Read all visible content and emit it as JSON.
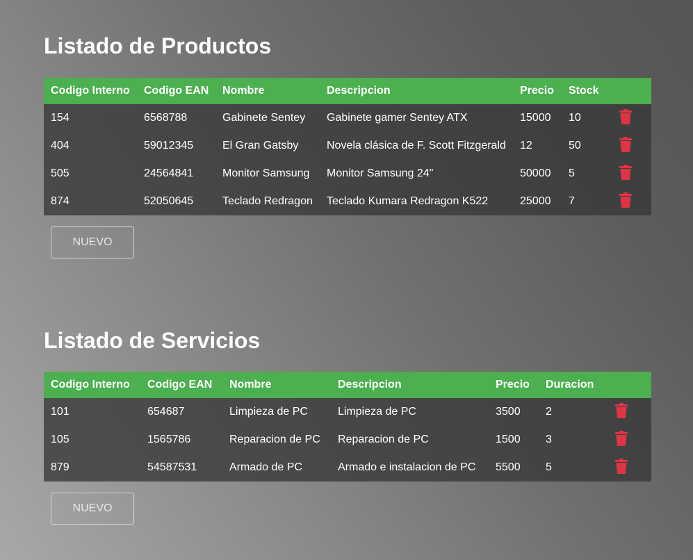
{
  "products": {
    "title": "Listado de Productos",
    "headers": [
      "Codigo Interno",
      "Codigo EAN",
      "Nombre",
      "Descripcion",
      "Precio",
      "Stock"
    ],
    "rows": [
      [
        "154",
        "6568788",
        "Gabinete Sentey",
        "Gabinete gamer Sentey ATX",
        "15000",
        "10"
      ],
      [
        "404",
        "59012345",
        "El Gran Gatsby",
        "Novela clásica de F. Scott Fitzgerald",
        "12",
        "50"
      ],
      [
        "505",
        "24564841",
        "Monitor Samsung",
        "Monitor Samsung 24\"",
        "50000",
        "5"
      ],
      [
        "874",
        "52050645",
        "Teclado Redragon",
        "Teclado Kumara Redragon K522",
        "25000",
        "7"
      ]
    ],
    "new_button": "NUEVO"
  },
  "services": {
    "title": "Listado de Servicios",
    "headers": [
      "Codigo Interno",
      "Codigo EAN",
      "Nombre",
      "Descripcion",
      "Precio",
      "Duracion"
    ],
    "rows": [
      [
        "101",
        "654687",
        "Limpieza de PC",
        "Limpieza de PC",
        "3500",
        "2"
      ],
      [
        "105",
        "1565786",
        "Reparacion de PC",
        "Reparacion de PC",
        "1500",
        "3"
      ],
      [
        "879",
        "54587531",
        "Armado de PC",
        "Armado e instalacion de PC",
        "5500",
        "5"
      ]
    ],
    "new_button": "NUEVO"
  },
  "icons": {
    "delete": "trash-icon"
  },
  "colors": {
    "header_green": "#4caf50",
    "delete_red": "#dc3545"
  }
}
